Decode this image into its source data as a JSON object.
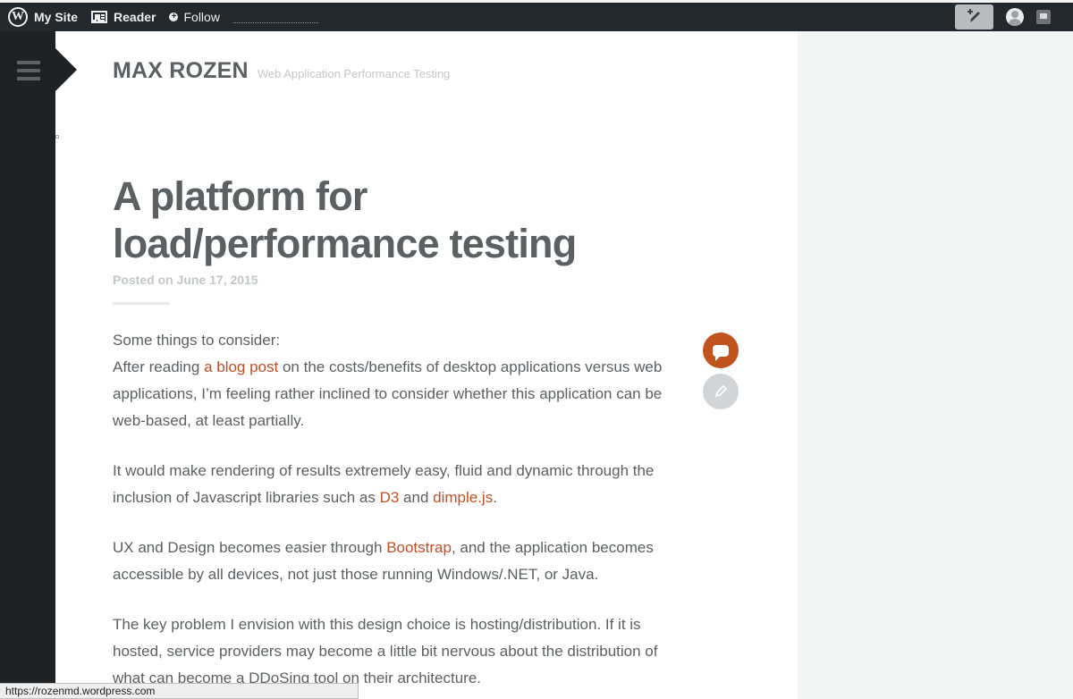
{
  "adminbar": {
    "my_site": "My Site",
    "reader": "Reader",
    "follow": "Follow"
  },
  "site": {
    "title": "MAX ROZEN",
    "description": "Web Application Performance Testing"
  },
  "post": {
    "title": "A platform for load/performance testing",
    "posted_prefix": "Posted on",
    "posted_date": "June 17, 2015",
    "paragraphs": [
      {
        "line1": "Some things to consider:",
        "text_before": "After reading ",
        "link1": "a blog post",
        "text_after": " on the costs/benefits of desktop applications versus web applications, I’m feeling rather inclined to consider whether this application can be web-based, at least partially."
      },
      {
        "text_before": "It would make rendering of results extremely easy, fluid and dynamic through the inclusion of Javascript libraries such as ",
        "link1": "D3",
        "text_middle": " and ",
        "link2": "dimple.js",
        "text_after": "."
      },
      {
        "text_before": "UX and Design becomes easier through ",
        "link1": "Bootstrap",
        "text_after": ", and the application becomes accessible by all devices, not just those running Windows/.NET, or Java."
      },
      {
        "text": "The key problem I envision with this design choice is hosting/distribution. If it is hosted, service providers may become a little bit nervous about the distribution of what can become a DDoSing tool on their architecture."
      }
    ]
  },
  "statusbar": {
    "url": "https://rozenmd.wordpress.com"
  },
  "icons": {
    "wp": "wordpress-logo-icon",
    "reader": "reader-icon",
    "follow": "plus-circle-icon",
    "write": "write-post-icon",
    "avatar": "user-avatar-icon",
    "notifications": "notifications-icon",
    "menu": "hamburger-menu-icon",
    "comment": "comment-bubble-icon",
    "edit": "pencil-icon"
  },
  "colors": {
    "adminbar": "#23282d",
    "accent": "#c14f24",
    "text": "#5b6063"
  }
}
